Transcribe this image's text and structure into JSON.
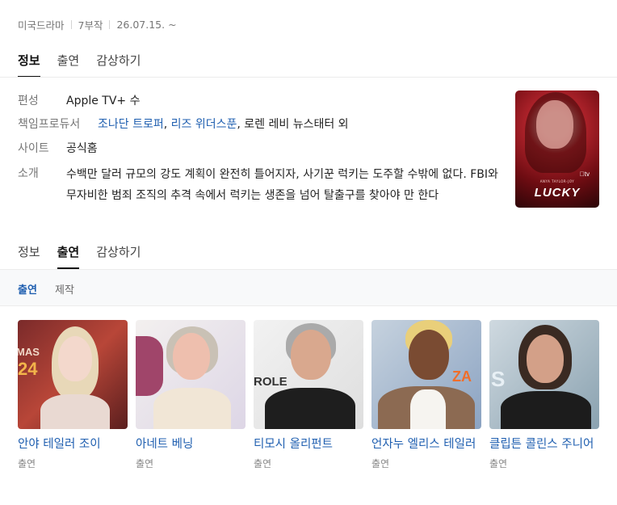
{
  "meta": {
    "category": "미국드라마",
    "episodes": "7부작",
    "date": "26.07.15. ~"
  },
  "tabs_top": [
    "정보",
    "출연",
    "감상하기"
  ],
  "info": {
    "genre_label": "편성",
    "genre_value": "Apple TV+ 수",
    "producer_label": "책임프로듀서",
    "producers": [
      "조나단 트로퍼",
      "리즈 위더스푼"
    ],
    "producers_rest": "로렌 레비 뉴스태터 외",
    "site_label": "사이트",
    "site_value": "공식홈",
    "desc_label": "소개",
    "description": "수백만 달러 규모의 강도 계획이 완전히 틀어지자, 사기꾼 럭키는 도주할 수밖에 없다. FBI와 무자비한 범죄 조직의 추격 속에서 럭키는 생존을 넘어 탈출구를 찾아야 만 한다"
  },
  "poster": {
    "service": "tv",
    "cast_line": "ANYA TAYLOR-JOY",
    "title": "LUCKY"
  },
  "tabs_bottom": [
    "정보",
    "출연",
    "감상하기"
  ],
  "subtabs": [
    "출연",
    "제작"
  ],
  "cast": [
    {
      "name": "안야 테일러 조이",
      "role": "출연"
    },
    {
      "name": "아네트 베닝",
      "role": "출연"
    },
    {
      "name": "티모시 올리펀트",
      "role": "출연"
    },
    {
      "name": "언자누 엘리스 테일러",
      "role": "출연"
    },
    {
      "name": "클립튼 콜린스 주니어",
      "role": "출연"
    }
  ],
  "colors": {
    "link": "#1f5fb0",
    "muted": "#767676"
  }
}
